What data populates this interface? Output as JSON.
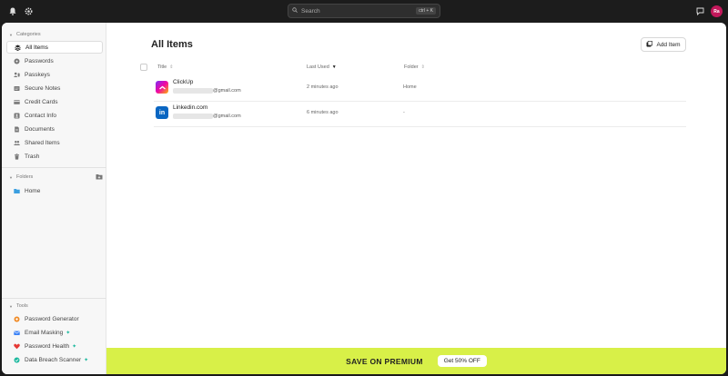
{
  "topbar": {
    "search_placeholder": "Search",
    "search_shortcut": "ctrl + K",
    "avatar_initials": "Ra"
  },
  "sidebar": {
    "categories_heading": "Categories",
    "categories": [
      {
        "label": "All Items",
        "icon": "layers-icon",
        "active": true
      },
      {
        "label": "Passwords",
        "icon": "password-icon"
      },
      {
        "label": "Passkeys",
        "icon": "passkey-icon"
      },
      {
        "label": "Secure Notes",
        "icon": "note-icon"
      },
      {
        "label": "Credit Cards",
        "icon": "credit-card-icon"
      },
      {
        "label": "Contact Info",
        "icon": "contact-icon"
      },
      {
        "label": "Documents",
        "icon": "document-icon"
      },
      {
        "label": "Shared Items",
        "icon": "shared-icon"
      },
      {
        "label": "Trash",
        "icon": "trash-icon"
      }
    ],
    "folders_heading": "Folders",
    "folders": [
      {
        "label": "Home",
        "icon": "folder-icon",
        "color": "#3b9fe0"
      }
    ],
    "tools_heading": "Tools",
    "tools": [
      {
        "label": "Password Generator",
        "icon": "generator-icon",
        "color": "#f08a24"
      },
      {
        "label": "Email Masking",
        "icon": "email-mask-icon",
        "color": "#3b82f6"
      },
      {
        "label": "Password Health",
        "icon": "heart-icon",
        "color": "#e53935"
      },
      {
        "label": "Data Breach Scanner",
        "icon": "scanner-icon",
        "color": "#1bb89e"
      }
    ]
  },
  "main": {
    "title": "All Items",
    "add_button": "Add Item",
    "columns": {
      "title": "Title",
      "last_used": "Last Used",
      "folder": "Folder"
    },
    "rows": [
      {
        "name": "ClickUp",
        "email_suffix": "@gmail.com",
        "last_used": "2 minutes ago",
        "folder": "Home",
        "logo": "clickup-logo"
      },
      {
        "name": "Linkedin.com",
        "email_suffix": "@gmail.com",
        "last_used": "6 minutes ago",
        "folder": "-",
        "logo": "linkedin-logo",
        "logo_text": "in"
      }
    ]
  },
  "banner": {
    "text": "SAVE ON PREMIUM",
    "cta": "Get 50% OFF",
    "color": "#d8f048"
  }
}
